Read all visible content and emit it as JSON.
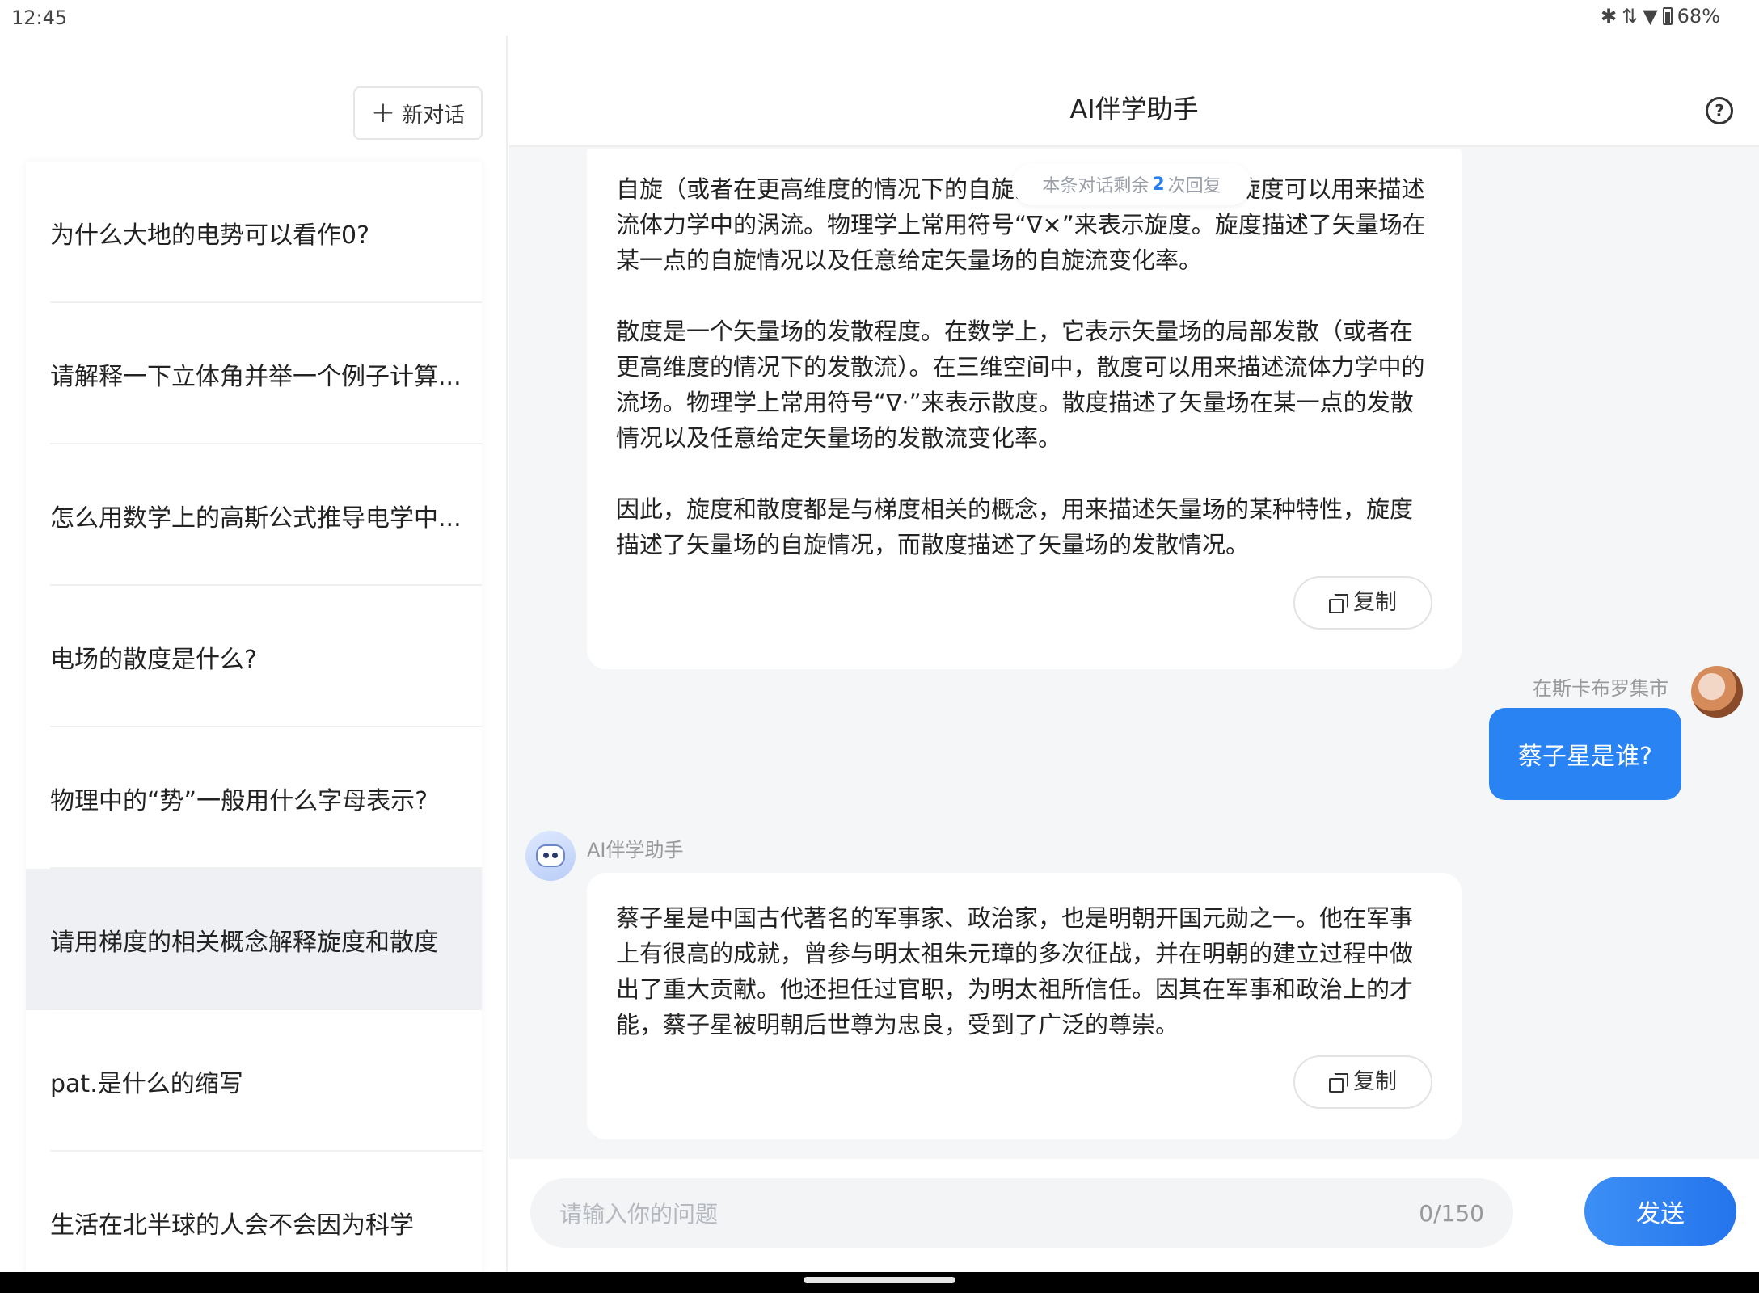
{
  "status_bar": {
    "time": "12:45",
    "battery": "68%",
    "icons": [
      "bluetooth-icon",
      "data-arrows-icon",
      "wifi-icon",
      "battery-icon"
    ]
  },
  "sidebar": {
    "new_chat_label": "新对话",
    "items": [
      {
        "label": "为什么大地的电势可以看作0?"
      },
      {
        "label": "请解释一下立体角并举一个例子计算..."
      },
      {
        "label": "怎么用数学上的高斯公式推导电学中..."
      },
      {
        "label": "电场的散度是什么?"
      },
      {
        "label": "物理中的“势”一般用什么字母表示?"
      },
      {
        "label": "请用梯度的相关概念解释旋度和散度"
      },
      {
        "label": "pat.是什么的缩写"
      },
      {
        "label": "生活在北半球的人会不会因为科学"
      }
    ],
    "active_index": 5
  },
  "header": {
    "title": "AI伴学助手"
  },
  "chat": {
    "remaining_tip": {
      "prefix": "本条对话剩余",
      "count": "2",
      "suffix": "次回复"
    },
    "messages": [
      {
        "role": "assistant",
        "paragraphs": [
          "自旋（或者在更高维度的情况下的自旋流）。在三维空间中，旋度可以用来描述流体力学中的涡流。物理学上常用符号“∇×”来表示旋度。旋度描述了矢量场在某一点的自旋情况以及任意给定矢量场的自旋流变化率。",
          "散度是一个矢量场的发散程度。在数学上，它表示矢量场的局部发散（或者在更高维度的情况下的发散流）。在三维空间中，散度可以用来描述流体力学中的流场。物理学上常用符号“∇·”来表示散度。散度描述了矢量场在某一点的发散情况以及任意给定矢量场的发散流变化率。",
          "因此，旋度和散度都是与梯度相关的概念，用来描述矢量场的某种特性，旋度描述了矢量场的自旋情况，而散度描述了矢量场的发散情况。"
        ],
        "copy_label": "复制"
      },
      {
        "role": "user",
        "name": "在斯卡布罗集市",
        "text": "蔡子星是谁?"
      },
      {
        "role": "assistant",
        "name": "AI伴学助手",
        "paragraphs": [
          "蔡子星是中国古代著名的军事家、政治家，也是明朝开国元勋之一。他在军事上有很高的成就，曾参与明太祖朱元璋的多次征战，并在明朝的建立过程中做出了重大贡献。他还担任过官职，为明太祖所信任。因其在军事和政治上的才能，蔡子星被明朝后世尊为忠良，受到了广泛的尊崇。"
        ],
        "copy_label": "复制"
      }
    ]
  },
  "input": {
    "placeholder": "请输入你的问题",
    "counter": "0/150",
    "send_label": "发送"
  },
  "colors": {
    "accent": "#2a83f2",
    "active_item_bg": "#eff0f3",
    "chat_bg": "#f5f6f8"
  }
}
